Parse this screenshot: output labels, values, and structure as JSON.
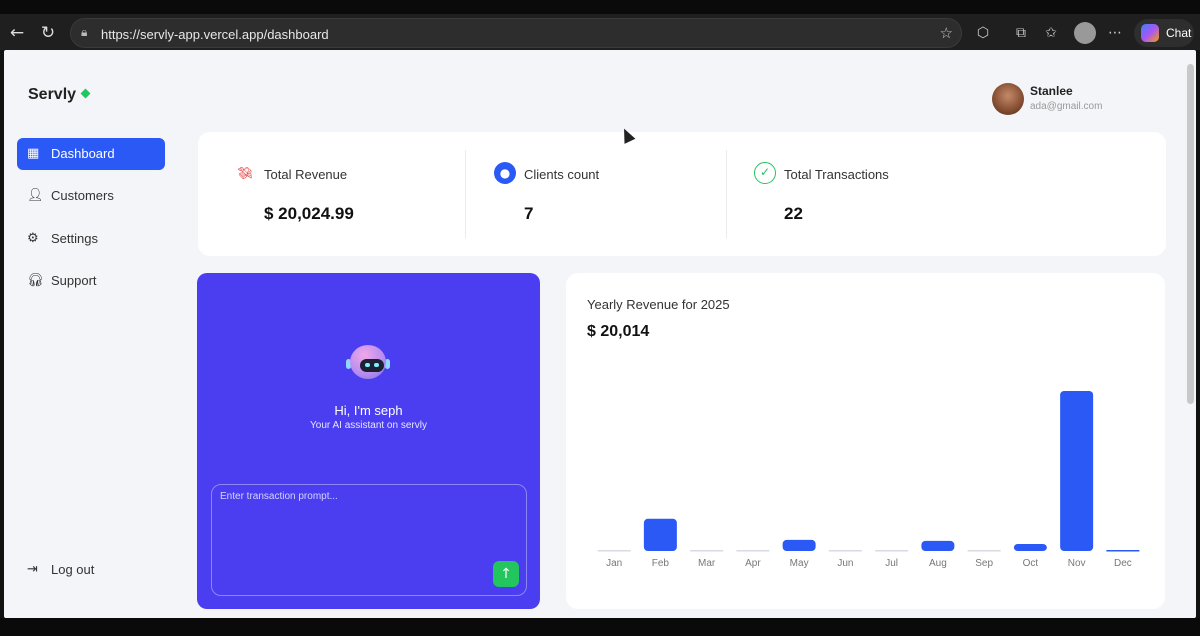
{
  "browser": {
    "url": "https://servly-app.vercel.app/dashboard",
    "chat_label": "Chat"
  },
  "sidebar": {
    "brand": "Servly",
    "items": [
      {
        "label": "Dashboard",
        "icon": "dashboard-grid-icon",
        "active": true
      },
      {
        "label": "Customers",
        "icon": "user-icon",
        "active": false
      },
      {
        "label": "Settings",
        "icon": "gear-icon",
        "active": false
      },
      {
        "label": "Support",
        "icon": "headset-icon",
        "active": false
      }
    ],
    "logout_label": "Log out"
  },
  "user": {
    "name": "Stanlee",
    "email": "ada@gmail.com"
  },
  "stats": [
    {
      "label": "Total Revenue",
      "value": "$ 20,024.99",
      "icon": "revenue-icon",
      "color": "#dc2626"
    },
    {
      "label": "Clients count",
      "value": "7",
      "icon": "client-icon",
      "color": "#2b59f5"
    },
    {
      "label": "Total Transactions",
      "value": "22",
      "icon": "transactions-icon",
      "color": "#22c55e"
    }
  ],
  "assistant": {
    "title": "Hi, I'm seph",
    "subtitle": "Your AI assistant on servly",
    "placeholder": "Enter transaction prompt...",
    "accent": "#4b3ef0",
    "send_color": "#22c55e"
  },
  "chart_data": {
    "type": "bar",
    "title": "Yearly Revenue for 2025",
    "total": "$ 20,014",
    "categories": [
      "Jan",
      "Feb",
      "Mar",
      "Apr",
      "May",
      "Jun",
      "Jul",
      "Aug",
      "Sep",
      "Oct",
      "Nov",
      "Dec"
    ],
    "values": [
      0,
      3200,
      0,
      0,
      1100,
      0,
      0,
      1000,
      0,
      700,
      15900,
      100
    ],
    "bar_color": "#2b59f5",
    "grid": false
  }
}
